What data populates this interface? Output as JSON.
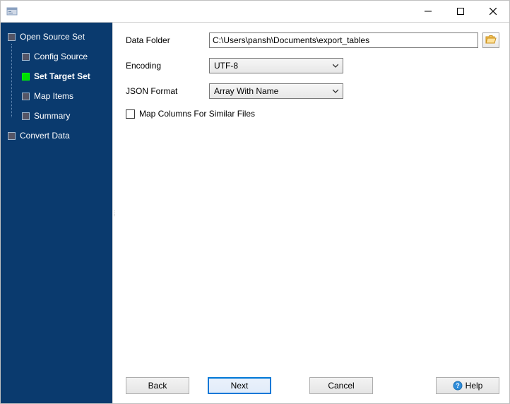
{
  "window": {
    "title": ""
  },
  "sidebar": {
    "items": [
      {
        "label": "Open Source Set",
        "children": [
          {
            "label": "Config Source"
          },
          {
            "label": "Set Target Set",
            "active": true
          },
          {
            "label": "Map Items"
          },
          {
            "label": "Summary"
          }
        ]
      },
      {
        "label": "Convert Data"
      }
    ]
  },
  "form": {
    "data_folder_label": "Data Folder",
    "data_folder_value": "C:\\Users\\pansh\\Documents\\export_tables",
    "encoding_label": "Encoding",
    "encoding_value": "UTF-8",
    "json_format_label": "JSON Format",
    "json_format_value": "Array With Name",
    "map_columns_label": "Map Columns For Similar Files",
    "map_columns_checked": false
  },
  "buttons": {
    "back": "Back",
    "next": "Next",
    "cancel": "Cancel",
    "help": "Help"
  },
  "icons": {
    "browse": "folder-open-icon",
    "help": "help-icon"
  }
}
